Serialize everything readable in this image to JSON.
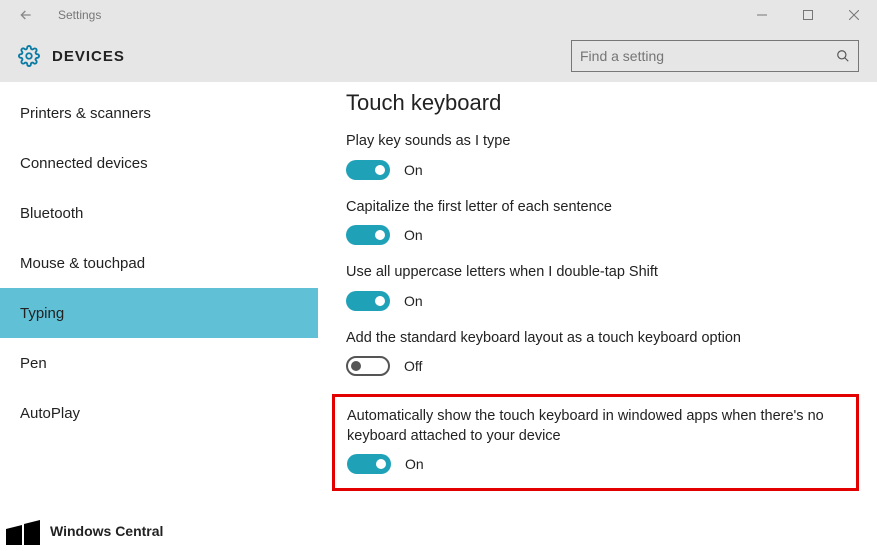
{
  "titlebar": {
    "app_name": "Settings"
  },
  "header": {
    "section": "DEVICES",
    "search_placeholder": "Find a setting"
  },
  "sidebar": {
    "items": [
      {
        "label": "Printers & scanners",
        "active": false
      },
      {
        "label": "Connected devices",
        "active": false
      },
      {
        "label": "Bluetooth",
        "active": false
      },
      {
        "label": "Mouse & touchpad",
        "active": false
      },
      {
        "label": "Typing",
        "active": true
      },
      {
        "label": "Pen",
        "active": false
      },
      {
        "label": "AutoPlay",
        "active": false
      }
    ]
  },
  "page": {
    "title": "Touch keyboard",
    "settings": [
      {
        "label": "Play key sounds as I type",
        "on": true,
        "state": "On",
        "highlight": false
      },
      {
        "label": "Capitalize the first letter of each sentence",
        "on": true,
        "state": "On",
        "highlight": false
      },
      {
        "label": "Use all uppercase letters when I double-tap Shift",
        "on": true,
        "state": "On",
        "highlight": false
      },
      {
        "label": "Add the standard keyboard layout as a touch keyboard option",
        "on": false,
        "state": "Off",
        "highlight": false
      },
      {
        "label": "Automatically show the touch keyboard in windowed apps when there's no keyboard attached to your device",
        "on": true,
        "state": "On",
        "highlight": true
      }
    ]
  },
  "brand": {
    "text": "Windows Central"
  },
  "colors": {
    "accent": "#1fa2b8",
    "sidebar_active": "#5fc0d6",
    "highlight_border": "#e30000"
  }
}
